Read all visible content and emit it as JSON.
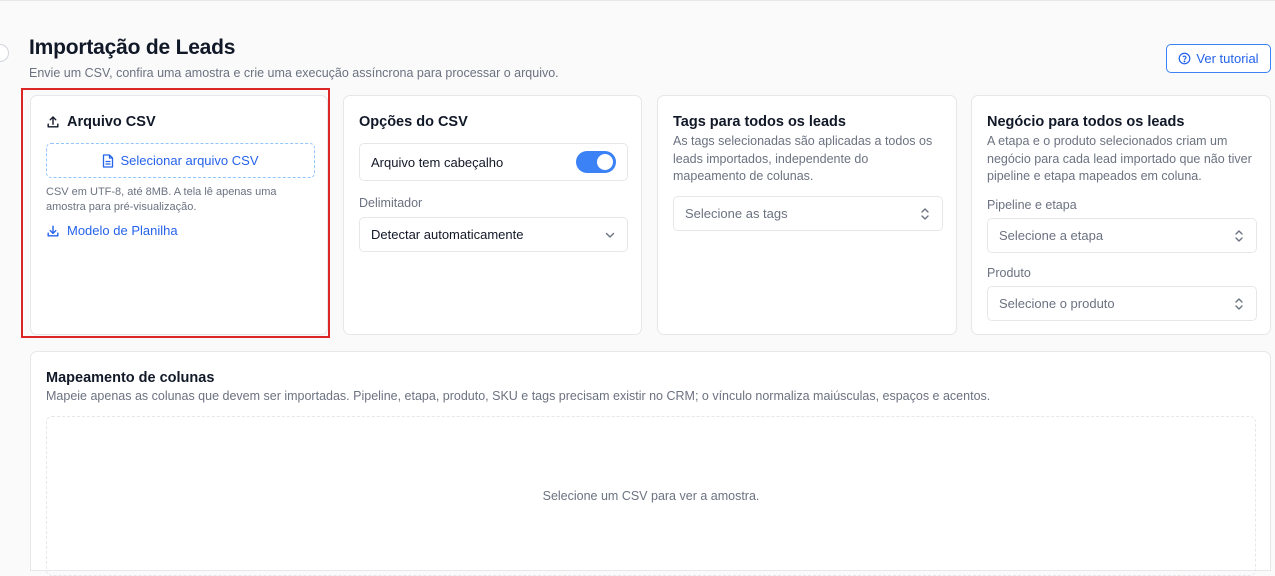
{
  "header": {
    "title": "Importação de Leads",
    "subtitle": "Envie um CSV, confira uma amostra e crie uma execução assíncrona para processar o arquivo.",
    "tutorial_label": "Ver tutorial"
  },
  "csv_file": {
    "title": "Arquivo CSV",
    "select_label": "Selecionar arquivo CSV",
    "hint": "CSV em UTF-8, até 8MB. A tela lê apenas uma amostra para pré-visualização.",
    "model_link": "Modelo de Planilha"
  },
  "csv_options": {
    "title": "Opções do CSV",
    "header_toggle_label": "Arquivo tem cabeçalho",
    "header_toggle_on": true,
    "delimiter_label": "Delimitador",
    "delimiter_value": "Detectar automaticamente"
  },
  "tags": {
    "title": "Tags para todos os leads",
    "description": "As tags selecionadas são aplicadas a todos os leads importados, independente do mapeamento de colunas.",
    "select_placeholder": "Selecione as tags"
  },
  "deal": {
    "title": "Negócio para todos os leads",
    "description": "A etapa e o produto selecionados criam um negócio para cada lead importado que não tiver pipeline e etapa mapeados em coluna.",
    "pipeline_label": "Pipeline e etapa",
    "pipeline_placeholder": "Selecione a etapa",
    "product_label": "Produto",
    "product_placeholder": "Selecione o produto"
  },
  "mapping": {
    "title": "Mapeamento de colunas",
    "description": "Mapeie apenas as colunas que devem ser importadas. Pipeline, etapa, produto, SKU e tags precisam existir no CRM; o vínculo normaliza maiúsculas, espaços e acentos.",
    "empty_text": "Selecione um CSV para ver a amostra."
  },
  "colors": {
    "accent": "#2563eb",
    "toggle": "#3b82f6",
    "highlight": "#dc2626"
  }
}
